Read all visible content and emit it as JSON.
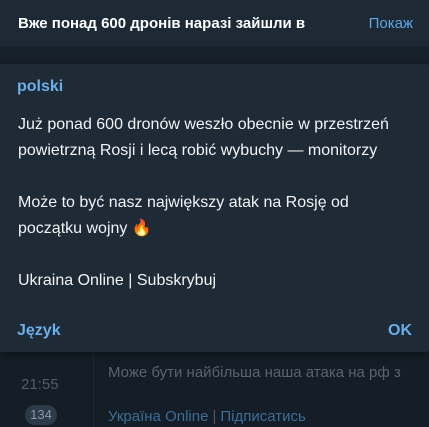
{
  "top_bar": {
    "title": "Вже понад 600 дронів наразі зайшли в",
    "action": "Покаж"
  },
  "dialog": {
    "language": "polski",
    "paragraph1_line1": "Już ponad 600 dronów weszło obecnie w przestrzeń",
    "paragraph1_line2": "powietrzną Rosji i lecą robić wybuchy — monitorzy",
    "paragraph2_line1": "Może to być nasz największy atak na Rosję od",
    "paragraph2_line2": "początku wojny",
    "emoji": "🔥",
    "footer_line": "Ukraina Online | Subskrybuj",
    "language_button": "Język",
    "ok_button": "OK"
  },
  "underlay": {
    "time": "21:55",
    "views_badge": "134",
    "text": "Може бути найбільша наша атака на рф з",
    "channel_link": "Україна Online",
    "separator": "|",
    "subscribe_link": "Підписатись"
  },
  "colors": {
    "background": "#17212b",
    "dialog": "#1f2a37",
    "accent": "#6caee8"
  }
}
